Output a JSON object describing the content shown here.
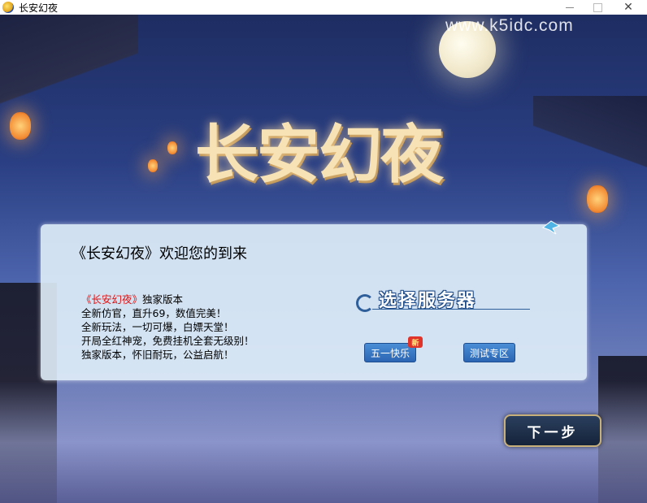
{
  "window": {
    "title": "长安幻夜",
    "icon": "app-icon",
    "minimize": "minimize-icon",
    "maximize": "maximize-icon",
    "close": "close-icon"
  },
  "watermark": "www.k5idc.com",
  "game_logo": "长安幻夜",
  "panel": {
    "welcome": "《长安幻夜》欢迎您的到来",
    "description": {
      "line1_highlight": "《长安幻夜》",
      "line1_rest": "独家版本",
      "line2": "全新仿官，直升69，数值完美！",
      "line3": "全新玩法，一切可爆，白嫖天堂！",
      "line4": "开局全红神宠，免费挂机全套无级别！",
      "line5": "独家版本，怀旧耐玩，公益启航！"
    },
    "server_header": "选择服务器",
    "servers": [
      {
        "label": "五一快乐",
        "badge": "新"
      },
      {
        "label": "测试专区"
      }
    ]
  },
  "next_button": "下一步",
  "colors": {
    "accent_red": "#e01010",
    "button_blue": "#2b65b3",
    "panel_bg": "#e1f0fa"
  }
}
